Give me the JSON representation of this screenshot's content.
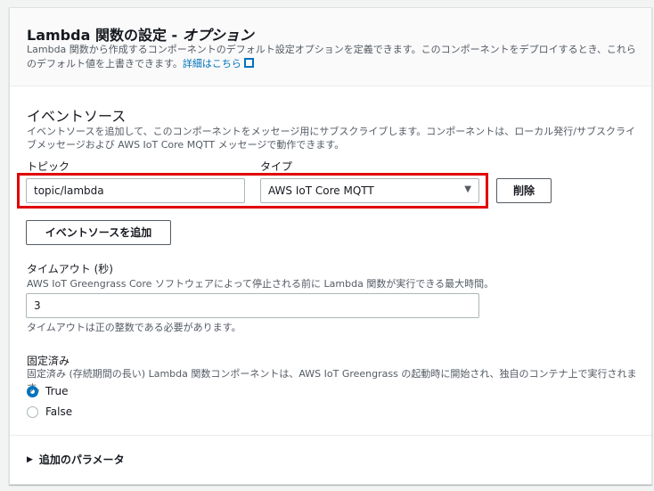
{
  "header": {
    "title_main": "Lambda 関数の設定 - ",
    "title_italic": "オプション",
    "description": "Lambda 関数から作成するコンポーネントのデフォルト設定オプションを定義できます。このコンポーネントをデプロイするとき、これらのデフォルト値を上書きできます。",
    "link": "詳細はこちら"
  },
  "event_source": {
    "heading": "イベントソース",
    "description": "イベントソースを追加して、このコンポーネントをメッセージ用にサブスクライブします。コンポーネントは、ローカル発行/サブスクライブメッセージおよび AWS IoT Core MQTT メッセージで動作できます。",
    "topic_label": "トピック",
    "topic_value": "topic/lambda",
    "type_label": "タイプ",
    "type_value": "AWS IoT Core MQTT",
    "delete_label": "削除",
    "add_label": "イベントソースを追加"
  },
  "timeout": {
    "label": "タイムアウト (秒)",
    "description": "AWS IoT Greengrass Core ソフトウェアによって停止される前に Lambda 関数が実行できる最大時間。",
    "value": "3",
    "hint": "タイムアウトは正の整数である必要があります。"
  },
  "pinned": {
    "label": "固定済み",
    "description": "固定済み (存続期間の長い) Lambda 関数コンポーネントは、AWS IoT Greengrass の起動時に開始され、独自のコンテナ上で実行されます。",
    "options": [
      "True",
      "False"
    ],
    "selected": "True"
  },
  "additional": {
    "label": "追加のパラメータ"
  },
  "colors": {
    "accent": "#0073bb",
    "highlight": "#e00000"
  }
}
